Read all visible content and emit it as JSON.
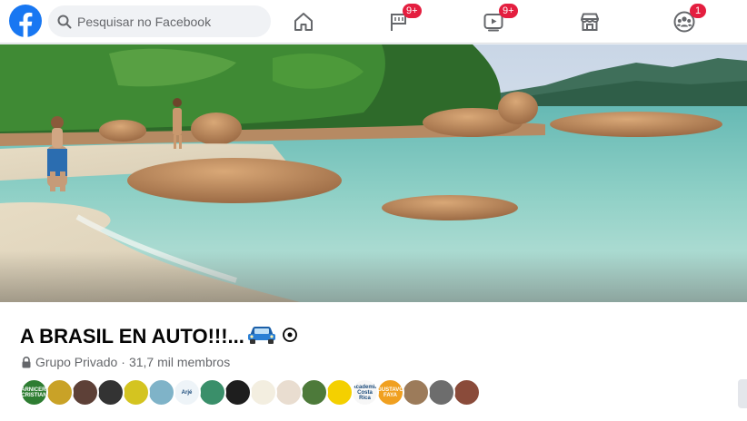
{
  "header": {
    "search": {
      "placeholder": "Pesquisar no Facebook"
    },
    "nav": [
      {
        "icon": "home-icon",
        "badge": ""
      },
      {
        "icon": "pages-flag-icon",
        "badge": "9+"
      },
      {
        "icon": "watch-video-icon",
        "badge": "9+"
      },
      {
        "icon": "marketplace-icon",
        "badge": ""
      },
      {
        "icon": "groups-icon",
        "badge": "1"
      }
    ]
  },
  "group": {
    "name": "A BRASIL EN AUTO!!!...",
    "privacy": "Grupo Privado",
    "separator": "·",
    "members": "31,7 mil membros"
  },
  "member_avatars": [
    {
      "label": "CARNICERIA CRISTIAN",
      "color": "#2e7d32"
    },
    {
      "label": "",
      "color": "#c9a227"
    },
    {
      "label": "",
      "color": "#5d4037"
    },
    {
      "label": "",
      "color": "#333333"
    },
    {
      "label": "",
      "color": "#d4c420"
    },
    {
      "label": "",
      "color": "#7fb3c8"
    },
    {
      "label": "Arjé",
      "color": "#eef4f8"
    },
    {
      "label": "",
      "color": "#3a8f6a"
    },
    {
      "label": "",
      "color": "#1e1e1e"
    },
    {
      "label": "",
      "color": "#f3eee0"
    },
    {
      "label": "",
      "color": "#e9ddd0"
    },
    {
      "label": "",
      "color": "#4d7a3a"
    },
    {
      "label": "",
      "color": "#f4d000"
    },
    {
      "label": "Academia Costa Rica",
      "color": "#f7f7f7"
    },
    {
      "label": "GUSTAVO FAYA",
      "color": "#f0a020"
    },
    {
      "label": "",
      "color": "#9c7b5a"
    },
    {
      "label": "",
      "color": "#6d6d6d"
    },
    {
      "label": "",
      "color": "#8a4b3a"
    }
  ],
  "colors": {
    "brand": "#1877f2",
    "badge": "#e41e3f"
  }
}
